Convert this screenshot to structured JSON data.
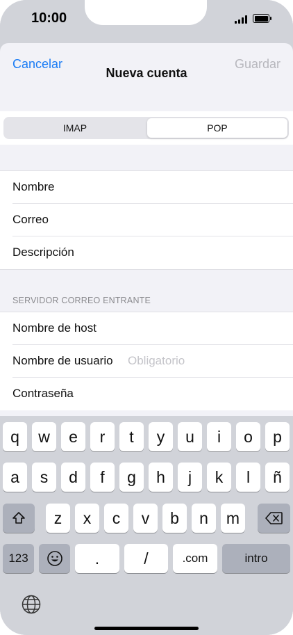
{
  "status_bar": {
    "time": "10:00"
  },
  "nav": {
    "cancel_label": "Cancelar",
    "title": "Nueva cuenta",
    "save_label": "Guardar"
  },
  "segmented": {
    "options": [
      "IMAP",
      "POP"
    ],
    "selected": "POP"
  },
  "account_fields": [
    {
      "label": "Nombre"
    },
    {
      "label": "Correo"
    },
    {
      "label": "Descripción"
    }
  ],
  "incoming_server": {
    "header": "SERVIDOR CORREO ENTRANTE",
    "fields": [
      {
        "label": "Nombre de host",
        "placeholder": ""
      },
      {
        "label": "Nombre de usuario",
        "placeholder": "Obligatorio"
      },
      {
        "label": "Contraseña",
        "placeholder": ""
      }
    ]
  },
  "keyboard": {
    "row1": [
      "q",
      "w",
      "e",
      "r",
      "t",
      "y",
      "u",
      "i",
      "o",
      "p"
    ],
    "row2": [
      "a",
      "s",
      "d",
      "f",
      "g",
      "h",
      "j",
      "k",
      "l",
      "ñ"
    ],
    "row3": [
      "z",
      "x",
      "c",
      "v",
      "b",
      "n",
      "m"
    ],
    "numbers_key": "123",
    "dot_key": ".",
    "slash_key": "/",
    "dotcom_key": ".com",
    "return_key": "intro",
    "icons": [
      "shift-icon",
      "delete-icon",
      "emoji-icon",
      "globe-icon"
    ]
  },
  "colors": {
    "accent": "#1a7cf5",
    "disabled": "#b7b7bd",
    "keyboard_bg": "#d1d3d9"
  }
}
